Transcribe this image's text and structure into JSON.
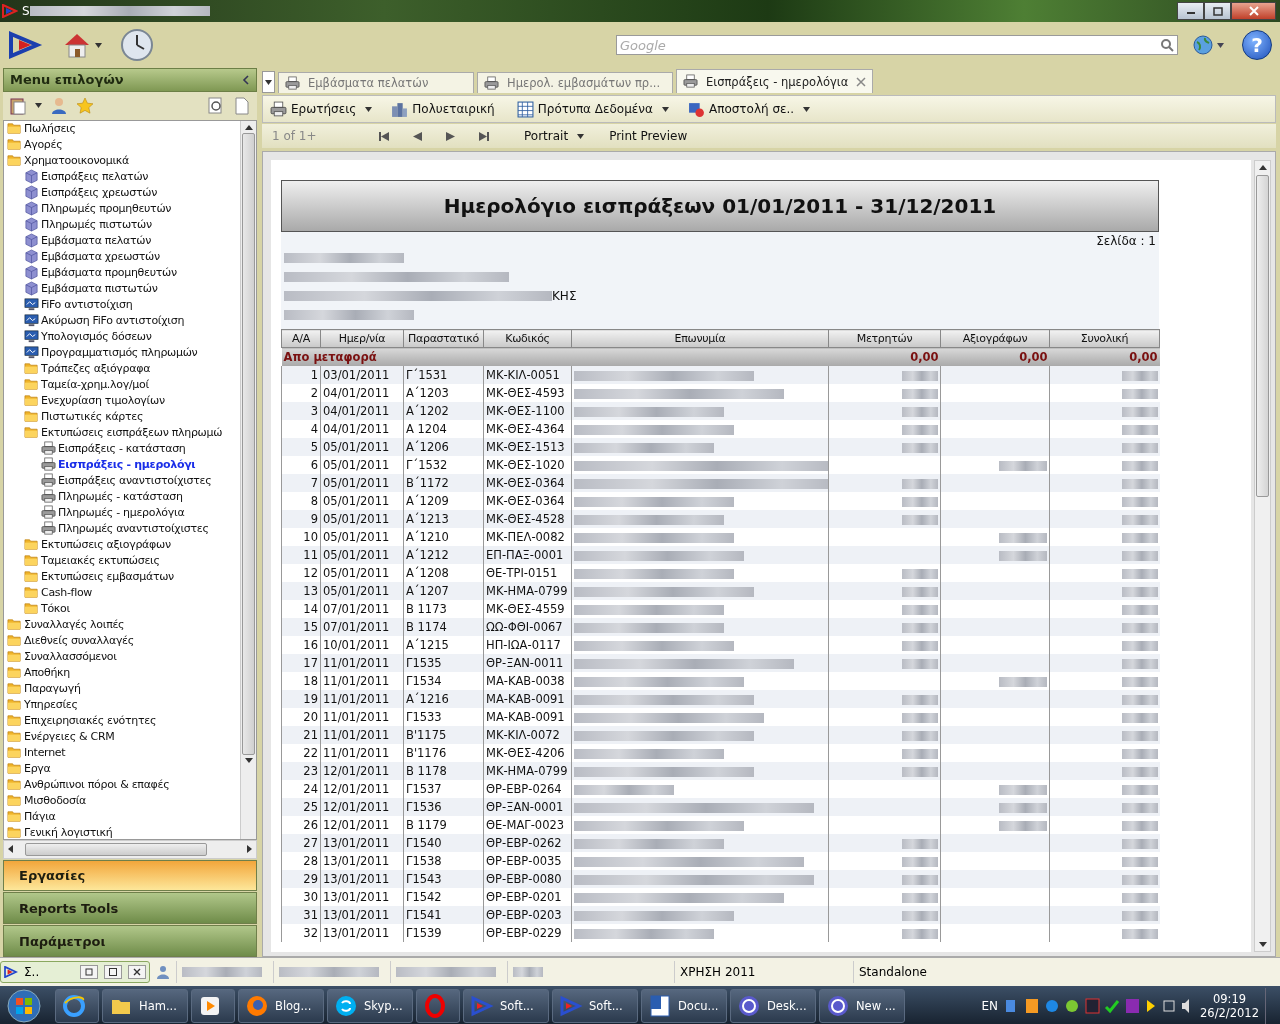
{
  "window": {
    "title": "S"
  },
  "header": {
    "search": {
      "placeholder": "Google"
    },
    "help_label": "?"
  },
  "sidebar": {
    "title": "Menu επιλογών",
    "tree": [
      {
        "label": "Πωλήσεις",
        "kind": "folder",
        "selected": false
      },
      {
        "label": "Αγορές",
        "kind": "folder",
        "selected": false
      },
      {
        "label": "Χρηματοοικονομικά",
        "kind": "folder",
        "selected": false,
        "children": [
          {
            "label": "Εισπράξεις πελατών",
            "kind": "module",
            "selected": false
          },
          {
            "label": "Εισπράξεις χρεωστών",
            "kind": "module",
            "selected": false
          },
          {
            "label": "Πληρωμές προμηθευτών",
            "kind": "module",
            "selected": false
          },
          {
            "label": "Πληρωμές πιστωτών",
            "kind": "module",
            "selected": false
          },
          {
            "label": "Εμβάσματα πελατών",
            "kind": "module",
            "selected": false
          },
          {
            "label": "Εμβάσματα χρεωστών",
            "kind": "module",
            "selected": false
          },
          {
            "label": "Εμβάσματα προμηθευτών",
            "kind": "module",
            "selected": false
          },
          {
            "label": "Εμβάσματα πιστωτών",
            "kind": "module",
            "selected": false
          },
          {
            "label": "FiFo αντιστοίχιση",
            "kind": "screen",
            "selected": false
          },
          {
            "label": "Ακύρωση FiFo αντιστοίχιση",
            "kind": "screen",
            "selected": false
          },
          {
            "label": "Υπολογισμός δόσεων",
            "kind": "screen",
            "selected": false
          },
          {
            "label": "Προγραμματισμός πληρωμών",
            "kind": "screen",
            "selected": false
          },
          {
            "label": "Τράπεζες αξιόγραφα",
            "kind": "folder",
            "selected": false
          },
          {
            "label": "Ταμεία-χρημ.λογ/μοί",
            "kind": "folder",
            "selected": false
          },
          {
            "label": "Ενεχυρίαση τιμολογίων",
            "kind": "folder",
            "selected": false
          },
          {
            "label": "Πιστωτικές κάρτες",
            "kind": "folder",
            "selected": false
          },
          {
            "label": "Εκτυπώσεις εισπράξεων πληρωμώ",
            "kind": "folder",
            "selected": false,
            "children": [
              {
                "label": "Εισπράξεις - κατάσταση",
                "kind": "printer",
                "selected": false
              },
              {
                "label": "Εισπράξεις - ημερολόγι",
                "kind": "printer",
                "selected": true
              },
              {
                "label": "Εισπράξεις αναντιστοίχιστες",
                "kind": "printer",
                "selected": false
              },
              {
                "label": "Πληρωμές - κατάσταση",
                "kind": "printer",
                "selected": false
              },
              {
                "label": "Πληρωμές - ημερολόγια",
                "kind": "printer",
                "selected": false
              },
              {
                "label": "Πληρωμές αναντιστοίχιστες",
                "kind": "printer",
                "selected": false
              }
            ]
          },
          {
            "label": "Εκτυπώσεις αξιογράφων",
            "kind": "folder",
            "selected": false
          },
          {
            "label": "Ταμειακές εκτυπώσεις",
            "kind": "folder",
            "selected": false
          },
          {
            "label": "Εκτυπώσεις εμβασμάτων",
            "kind": "folder",
            "selected": false
          },
          {
            "label": "Cash-flow",
            "kind": "folder",
            "selected": false
          },
          {
            "label": "Τόκοι",
            "kind": "folder",
            "selected": false
          }
        ]
      },
      {
        "label": "Συναλλαγές λοιπές",
        "kind": "folder",
        "selected": false
      },
      {
        "label": "Διεθνείς συναλλαγές",
        "kind": "folder",
        "selected": false
      },
      {
        "label": "Συναλλασσόμενοι",
        "kind": "folder",
        "selected": false
      },
      {
        "label": "Αποθήκη",
        "kind": "folder",
        "selected": false
      },
      {
        "label": "Παραγωγή",
        "kind": "folder",
        "selected": false
      },
      {
        "label": "Υπηρεσίες",
        "kind": "folder",
        "selected": false
      },
      {
        "label": "Επιχειρησιακές ενότητες",
        "kind": "folder",
        "selected": false
      },
      {
        "label": "Ενέργειες & CRM",
        "kind": "folder",
        "selected": false
      },
      {
        "label": "Internet",
        "kind": "folder",
        "selected": false
      },
      {
        "label": "Εργα",
        "kind": "folder",
        "selected": false
      },
      {
        "label": "Ανθρώπινοι πόροι & επαφές",
        "kind": "folder",
        "selected": false
      },
      {
        "label": "Μισθοδοσία",
        "kind": "folder",
        "selected": false
      },
      {
        "label": "Πάγια",
        "kind": "folder",
        "selected": false
      },
      {
        "label": "Γενική λογιστική",
        "kind": "folder",
        "selected": false
      }
    ],
    "sections": [
      {
        "label": "Εργασίες",
        "selected": true
      },
      {
        "label": "Reports Tools",
        "selected": false
      },
      {
        "label": "Παράμετροι",
        "selected": false
      }
    ]
  },
  "tabs": [
    {
      "label": "Εμβάσματα πελατών",
      "selected": false
    },
    {
      "label": "Ημερολ. εμβασμάτων πρ...",
      "selected": false
    },
    {
      "label": "Εισπράξεις - ημερολόγια",
      "selected": true
    }
  ],
  "toolbar": [
    {
      "label": "Ερωτήσεις",
      "kind": "printer",
      "dropdown": true
    },
    {
      "label": "Πολυεταιρική",
      "kind": "buildings",
      "dropdown": false
    },
    {
      "label": "Πρότυπα Δεδομένα",
      "kind": "grid",
      "dropdown": true
    },
    {
      "label": "Αποστολή σε..",
      "kind": "send",
      "dropdown": true
    }
  ],
  "preview_bar": {
    "page_info": "1 of 1+",
    "orientation": "Portrait",
    "print_preview": "Print Preview"
  },
  "report": {
    "title": "Ημερολόγιο εισπράξεων 01/01/2011 - 31/12/2011",
    "page_label": "Σελίδα : 1",
    "address_tail": "ΚΗΣ",
    "columns": [
      "Α/Α",
      "Ημερ/νία",
      "Παραστατικό",
      "Κωδικός",
      "Επωνυμία",
      "Μετρητών",
      "Αξιογράφων",
      "Συνολική"
    ],
    "carried": {
      "label": "Απο μεταφορά",
      "cash": "0,00",
      "cheques": "0,00",
      "total": "0,00"
    },
    "rows": [
      {
        "no": "1",
        "date": "03/01/2011",
        "doc": "Γ΄1531",
        "code": "ΜΚ-ΚΙΛ-0051",
        "kind": "cash"
      },
      {
        "no": "2",
        "date": "04/01/2011",
        "doc": "Α΄1203",
        "code": "ΜΚ-ΘΕΣ-4593",
        "kind": "cash"
      },
      {
        "no": "3",
        "date": "04/01/2011",
        "doc": "Α΄1202",
        "code": "ΜΚ-ΘΕΣ-1100",
        "kind": "cash"
      },
      {
        "no": "4",
        "date": "04/01/2011",
        "doc": "Α 1204",
        "code": "ΜΚ-ΘΕΣ-4364",
        "kind": "cash"
      },
      {
        "no": "5",
        "date": "05/01/2011",
        "doc": "Α΄1206",
        "code": "ΜΚ-ΘΕΣ-1513",
        "kind": "cash"
      },
      {
        "no": "6",
        "date": "05/01/2011",
        "doc": "Γ΄1532",
        "code": "ΜΚ-ΘΕΣ-1020",
        "kind": "cheque"
      },
      {
        "no": "7",
        "date": "05/01/2011",
        "doc": "Β΄1172",
        "code": "ΜΚ-ΘΕΣ-0364",
        "kind": "cash"
      },
      {
        "no": "8",
        "date": "05/01/2011",
        "doc": "Α΄1209",
        "code": "ΜΚ-ΘΕΣ-0364",
        "kind": "cash"
      },
      {
        "no": "9",
        "date": "05/01/2011",
        "doc": "Α΄1213",
        "code": "ΜΚ-ΘΕΣ-4528",
        "kind": "cash"
      },
      {
        "no": "10",
        "date": "05/01/2011",
        "doc": "Α΄1210",
        "code": "ΜΚ-ΠΕΛ-0082",
        "kind": "cheque"
      },
      {
        "no": "11",
        "date": "05/01/2011",
        "doc": "Α΄1212",
        "code": "ΕΠ-ΠΑΞ-0001",
        "kind": "cheque"
      },
      {
        "no": "12",
        "date": "05/01/2011",
        "doc": "Α΄1208",
        "code": "ΘΕ-ΤΡΙ-0151",
        "kind": "cash"
      },
      {
        "no": "13",
        "date": "05/01/2011",
        "doc": "Α΄1207",
        "code": "ΜΚ-ΗΜΑ-0799",
        "kind": "cash"
      },
      {
        "no": "14",
        "date": "07/01/2011",
        "doc": "Β 1173",
        "code": "ΜΚ-ΘΕΣ-4559",
        "kind": "cash"
      },
      {
        "no": "15",
        "date": "07/01/2011",
        "doc": "Β 1174",
        "code": "ΩΩ-ΦΘΙ-0067",
        "kind": "cash"
      },
      {
        "no": "16",
        "date": "10/01/2011",
        "doc": "Α΄1215",
        "code": "ΗΠ-ΙΩΑ-0117",
        "kind": "cash"
      },
      {
        "no": "17",
        "date": "11/01/2011",
        "doc": "Γ1535",
        "code": "ΘΡ-ΞΑΝ-0011",
        "kind": "cash"
      },
      {
        "no": "18",
        "date": "11/01/2011",
        "doc": "Γ1534",
        "code": "ΜΑ-ΚΑΒ-0038",
        "kind": "cheque"
      },
      {
        "no": "19",
        "date": "11/01/2011",
        "doc": "Α΄1216",
        "code": "ΜΑ-ΚΑΒ-0091",
        "kind": "cash"
      },
      {
        "no": "20",
        "date": "11/01/2011",
        "doc": "Γ1533",
        "code": "ΜΑ-ΚΑΒ-0091",
        "kind": "cash"
      },
      {
        "no": "21",
        "date": "11/01/2011",
        "doc": "Β'1175",
        "code": "ΜΚ-ΚΙΛ-0072",
        "kind": "cash"
      },
      {
        "no": "22",
        "date": "11/01/2011",
        "doc": "Β'1176",
        "code": "ΜΚ-ΘΕΣ-4206",
        "kind": "cash"
      },
      {
        "no": "23",
        "date": "12/01/2011",
        "doc": "Β 1178",
        "code": "ΜΚ-ΗΜΑ-0799",
        "kind": "cash"
      },
      {
        "no": "24",
        "date": "12/01/2011",
        "doc": "Γ1537",
        "code": "ΘΡ-ΕΒΡ-0264",
        "kind": "cheque"
      },
      {
        "no": "25",
        "date": "12/01/2011",
        "doc": "Γ1536",
        "code": "ΘΡ-ΞΑΝ-0001",
        "kind": "cheque"
      },
      {
        "no": "26",
        "date": "12/01/2011",
        "doc": "Β 1179",
        "code": "ΘΕ-ΜΑΓ-0023",
        "kind": "cheque"
      },
      {
        "no": "27",
        "date": "13/01/2011",
        "doc": "Γ1540",
        "code": "ΘΡ-ΕΒΡ-0262",
        "kind": "cash"
      },
      {
        "no": "28",
        "date": "13/01/2011",
        "doc": "Γ1538",
        "code": "ΘΡ-ΕΒΡ-0035",
        "kind": "cash"
      },
      {
        "no": "29",
        "date": "13/01/2011",
        "doc": "Γ1543",
        "code": "ΘΡ-ΕΒΡ-0080",
        "kind": "cash"
      },
      {
        "no": "30",
        "date": "13/01/2011",
        "doc": "Γ1542",
        "code": "ΘΡ-ΕΒΡ-0201",
        "kind": "cash"
      },
      {
        "no": "31",
        "date": "13/01/2011",
        "doc": "Γ1541",
        "code": "ΘΡ-ΕΒΡ-0203",
        "kind": "cash"
      },
      {
        "no": "32",
        "date": "13/01/2011",
        "doc": "Γ1539",
        "code": "ΘΡ-ΕΒΡ-0229",
        "kind": "cash"
      }
    ]
  },
  "status_bar": {
    "minimized_window": "Σ..",
    "fiscal_year": "ΧΡΗΣΗ 2011",
    "mode": "Standalone"
  },
  "taskbar": {
    "items": [
      {
        "kind": "ie"
      },
      {
        "kind": "folder",
        "label": "Ham..."
      },
      {
        "kind": "media"
      },
      {
        "kind": "firefox",
        "label": "Blog..."
      },
      {
        "kind": "skype",
        "label": "Skyp..."
      },
      {
        "kind": "opera"
      },
      {
        "kind": "app",
        "label": "Soft..."
      },
      {
        "kind": "app",
        "label": "Soft..."
      },
      {
        "kind": "word",
        "label": "Docu..."
      },
      {
        "kind": "swirl",
        "label": "Desk..."
      },
      {
        "kind": "swirl",
        "label": "New ..."
      }
    ],
    "language": "EN",
    "time": "09:19",
    "date": "26/2/2012"
  }
}
